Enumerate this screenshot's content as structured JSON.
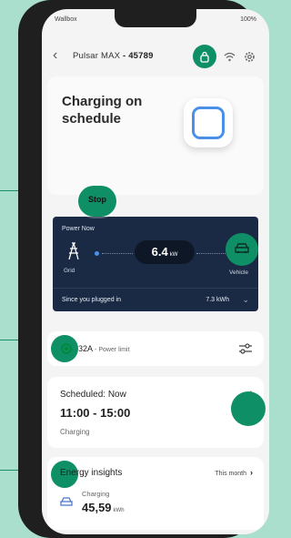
{
  "status_bar": {
    "carrier": "Wallbox",
    "battery": "100%"
  },
  "header": {
    "device_label": "Pulsar MAX",
    "device_id": "- 45789"
  },
  "hero": {
    "title": "Charging on schedule",
    "stop_label": "Stop"
  },
  "power": {
    "label": "Power Now",
    "value": "6.4",
    "unit": "kW",
    "grid_label": "Grid",
    "vehicle_label": "Vehicle",
    "plugged_label": "Since you plugged in",
    "plugged_value": "7.3 kWh"
  },
  "power_limit": {
    "current": "32A",
    "label": "Power limit"
  },
  "schedule": {
    "title": "Scheduled: Now",
    "time_range": "11:00 - 15:00",
    "status": "Charging"
  },
  "insights": {
    "title": "Energy insights",
    "period": "This month",
    "sublabel": "Charging",
    "value": "45,59",
    "unit": "kWh"
  },
  "colors": {
    "accent": "#0f8f66",
    "panel": "#1b2a44",
    "brand_blue": "#4a90e8",
    "background": "#a9dfcc"
  },
  "icons": [
    "back-chevron-icon",
    "lock-icon",
    "wifi-icon",
    "gear-icon",
    "grid-tower-icon",
    "vehicle-icon",
    "power-limit-icon",
    "sliders-icon",
    "chevron-right-icon",
    "car-icon"
  ]
}
